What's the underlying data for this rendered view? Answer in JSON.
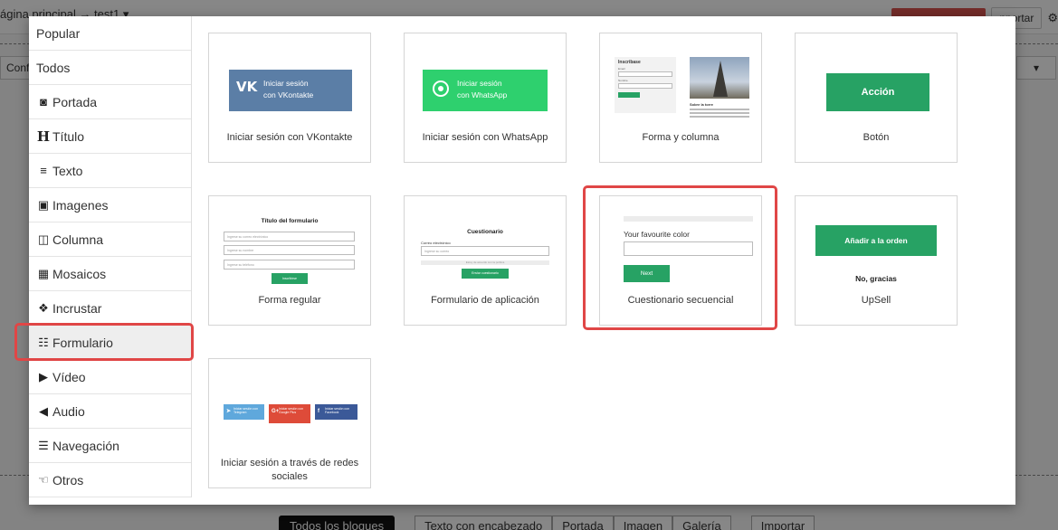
{
  "background": {
    "breadcrumb": "ágina principal → test1 ▾",
    "config_label": "Config",
    "right_button_label": "nportar",
    "bottom_bar": {
      "all_blocks": "Todos los bloques",
      "tabs": [
        "Texto con encabezado",
        "Portada",
        "Imagen",
        "Galería"
      ],
      "import": "Importar"
    }
  },
  "sidebar": {
    "items": [
      {
        "label": "Popular",
        "icon": ""
      },
      {
        "label": "Todos",
        "icon": ""
      },
      {
        "label": "Portada",
        "icon": "image-frame-icon"
      },
      {
        "label": "Título",
        "icon": "heading-icon"
      },
      {
        "label": "Texto",
        "icon": "text-lines-icon"
      },
      {
        "label": "Imagenes",
        "icon": "picture-icon"
      },
      {
        "label": "Columna",
        "icon": "columns-icon"
      },
      {
        "label": "Mosaicos",
        "icon": "tiles-icon"
      },
      {
        "label": "Incrustar",
        "icon": "cubes-icon"
      },
      {
        "label": "Formulario",
        "icon": "form-icon"
      },
      {
        "label": "Vídeo",
        "icon": "youtube-icon"
      },
      {
        "label": "Audio",
        "icon": "speaker-icon"
      },
      {
        "label": "Navegación",
        "icon": "menu-icon"
      },
      {
        "label": "Otros",
        "icon": "hand-icon"
      }
    ],
    "active_index": 9
  },
  "cards": [
    {
      "label": "Iniciar sesión con VKontakte",
      "preview": {
        "button": "Iniciar sesión con VKontakte",
        "line1": "Iniciar sesión",
        "line2": "con VKontakte"
      }
    },
    {
      "label": "Iniciar sesión con WhatsApp",
      "preview": {
        "line1": "Iniciar sesión",
        "line2": "con WhatsApp"
      }
    },
    {
      "label": "Forma y columna",
      "preview": {
        "form_title": "Inscribase",
        "field1": "Email",
        "field2": "Nombre",
        "button": "Enviar",
        "side_title": "Sobre la torre"
      }
    },
    {
      "label": "Botón",
      "preview": {
        "button": "Acción"
      }
    },
    {
      "label": "Forma regular",
      "preview": {
        "title": "Título del formulario",
        "field1": "Ingrese su correo electrónico",
        "field2": "Ingrese su nombre",
        "field3": "Ingrese su teléfono",
        "button": "Inscribirse"
      }
    },
    {
      "label": "Formulario de aplicación",
      "preview": {
        "title": "Cuestionario",
        "field_label": "Correo electrónico",
        "field_placeholder": "Ingrese su correo",
        "check": "Estoy de acuerdo con la política",
        "button": "Enviar cuestionario"
      }
    },
    {
      "label": "Cuestionario secuencial",
      "preview": {
        "question": "Your favourite color",
        "button": "Next"
      }
    },
    {
      "label": "UpSell",
      "preview": {
        "button": "Añadir a la orden",
        "decline": "No, gracias"
      }
    },
    {
      "label": "Iniciar sesión a través de redes sociales",
      "preview": {
        "telegram": "Iniciar sesión con Telegram",
        "google": "Iniciar sesión con Google Plus",
        "facebook": "Iniciar sesión con Facebook"
      }
    }
  ],
  "highlighted_card_index": 6,
  "colors": {
    "accent_green": "#27a264",
    "highlight_red": "#e04646",
    "vk_blue": "#5b7ea6",
    "whatsapp_green": "#2ed06e"
  }
}
